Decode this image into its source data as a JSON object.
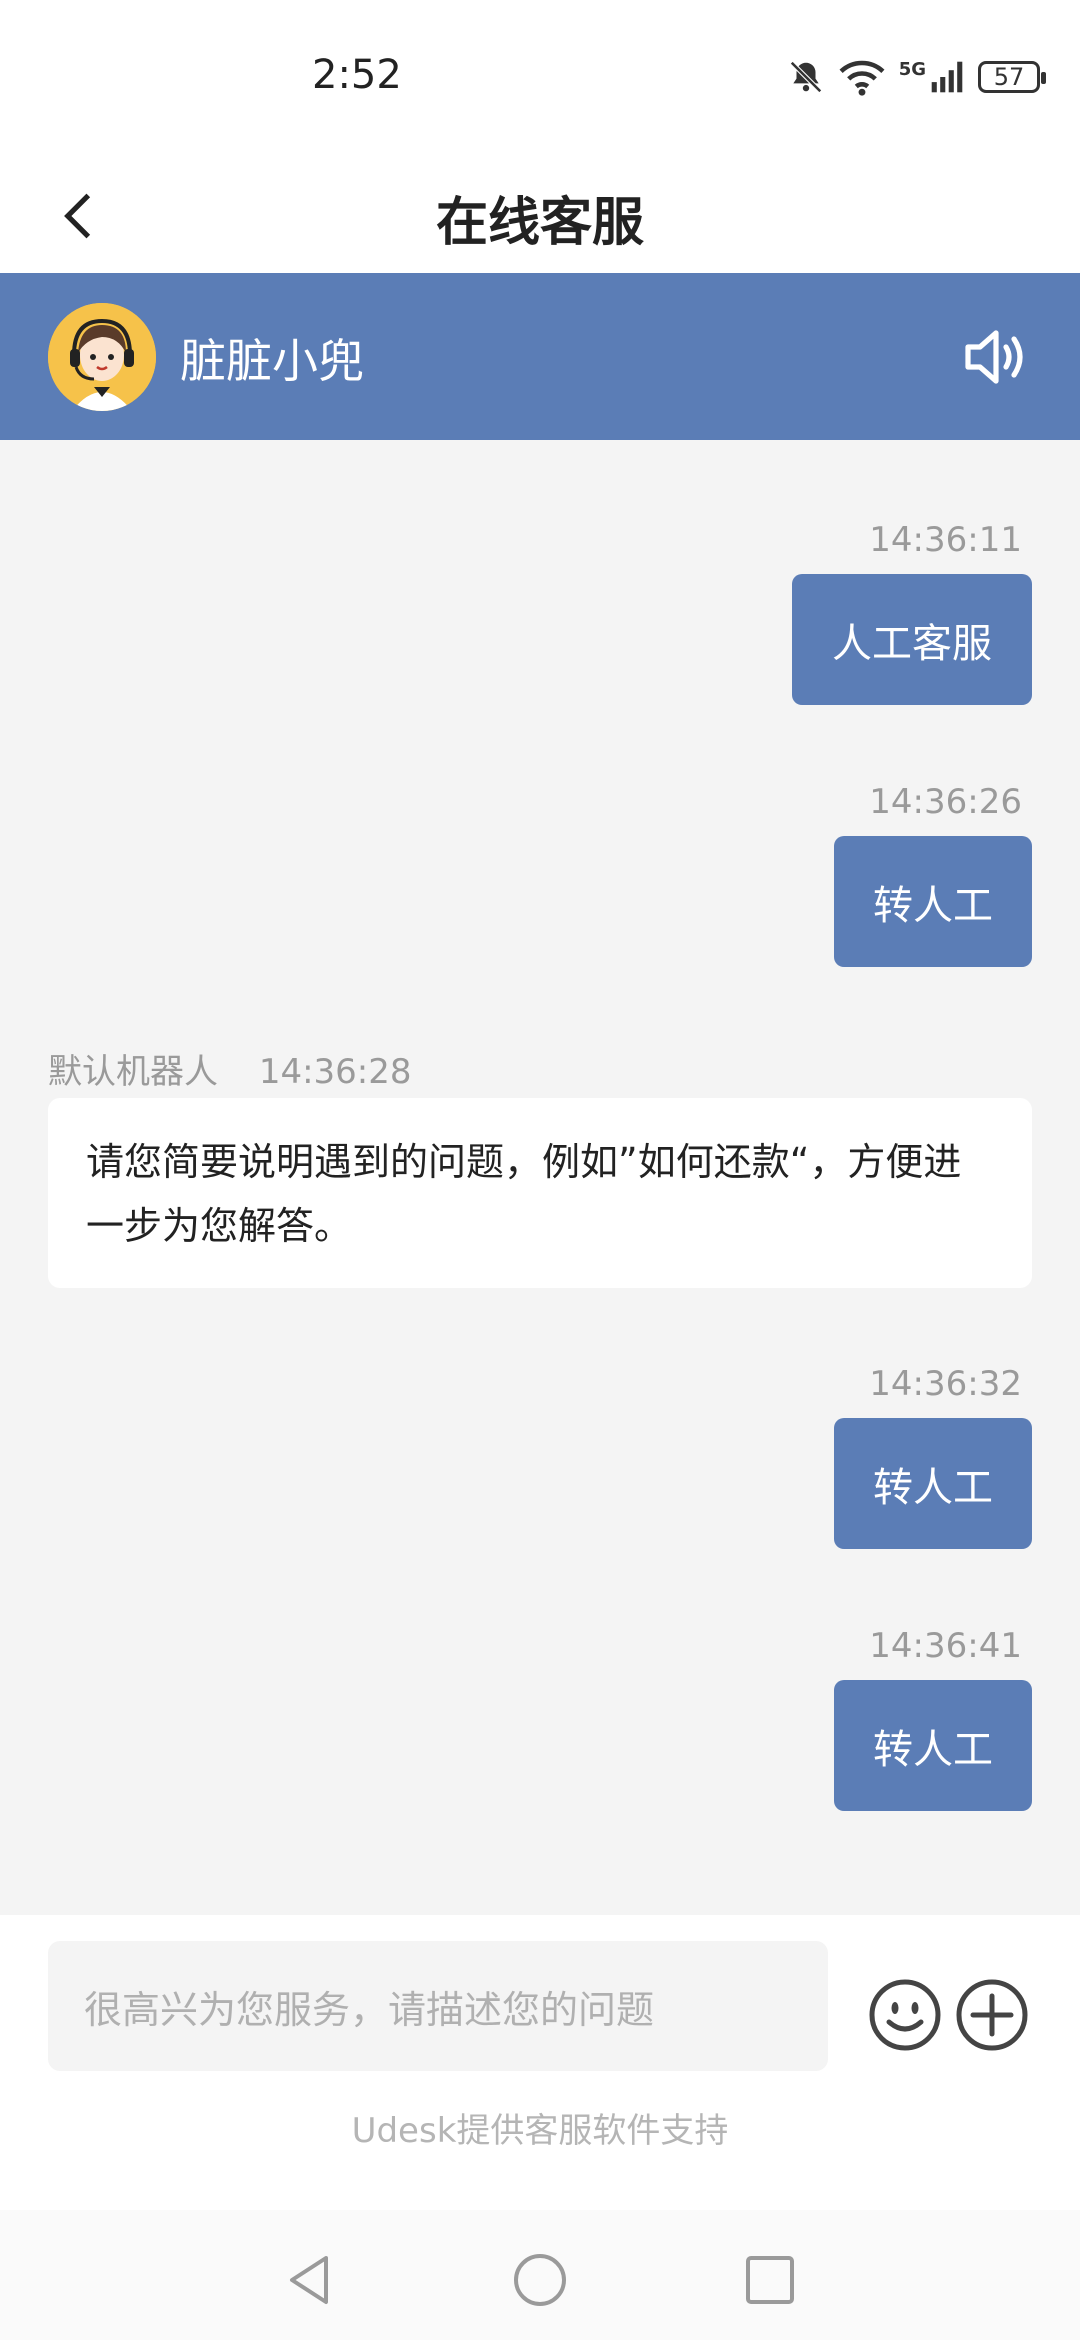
{
  "status_bar": {
    "time": "2:52",
    "battery": "57",
    "network": "5G"
  },
  "header": {
    "title": "在线客服",
    "back_icon": "chevron-left-icon"
  },
  "agent": {
    "name": "脏脏小兜",
    "avatar_icon": "support-agent-avatar",
    "speaker_icon": "speaker-icon"
  },
  "messages": [
    {
      "side": "right",
      "time": "14:36:11",
      "text": "人工客服"
    },
    {
      "side": "right",
      "time": "14:36:26",
      "text": "转人工"
    },
    {
      "side": "left",
      "sender": "默认机器人",
      "time": "14:36:28",
      "text": "请您简要说明遇到的问题，例如”如何还款“，方便进一步为您解答。"
    },
    {
      "side": "right",
      "time": "14:36:32",
      "text": "转人工"
    },
    {
      "side": "right",
      "time": "14:36:41",
      "text": "转人工"
    }
  ],
  "composer": {
    "placeholder": "很高兴为您服务，请描述您的问题",
    "emoji_icon": "emoji-icon",
    "plus_icon": "plus-circle-icon"
  },
  "footer": {
    "note": "Udesk提供客服软件支持"
  },
  "colors": {
    "accent": "#5b7db6",
    "background": "#f4f4f4",
    "avatar_bg": "#f6c24a"
  }
}
